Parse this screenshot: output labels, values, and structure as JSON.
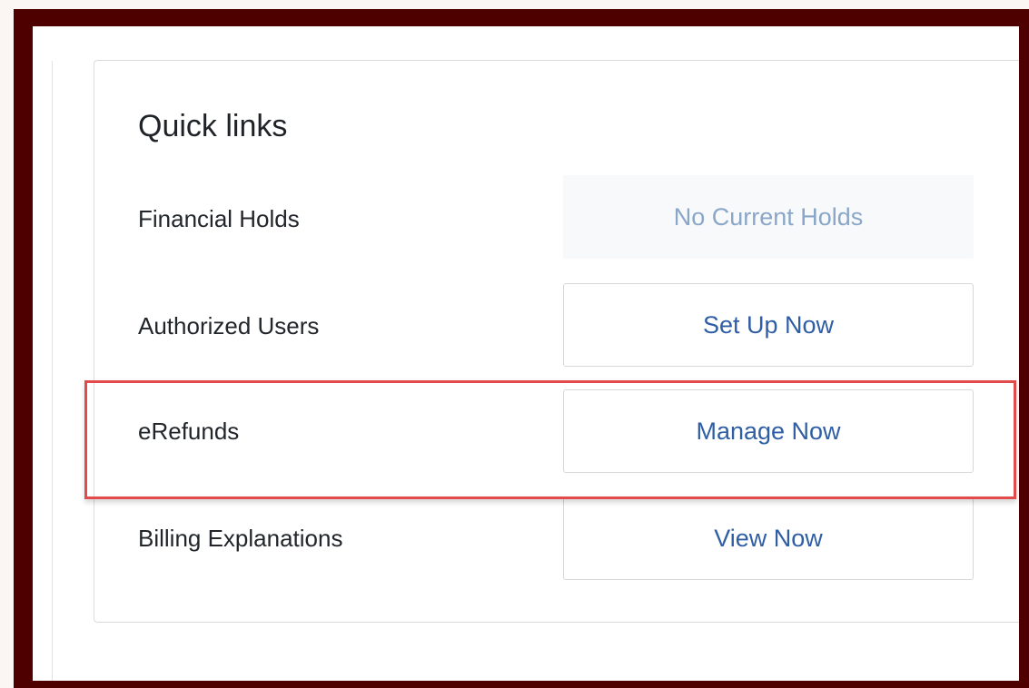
{
  "quick_links": {
    "title": "Quick links",
    "rows": [
      {
        "label": "Financial Holds",
        "value": "No Current Holds"
      },
      {
        "label": "Authorized Users",
        "button": "Set Up Now"
      },
      {
        "label": "eRefunds",
        "button": "Manage Now"
      },
      {
        "label": "Billing Explanations",
        "button": "View Now"
      }
    ]
  },
  "colors": {
    "frame": "#4e0000",
    "highlight": "#e14b4b",
    "link_text": "#2f5ea5",
    "status_text": "#8aa6c8"
  }
}
